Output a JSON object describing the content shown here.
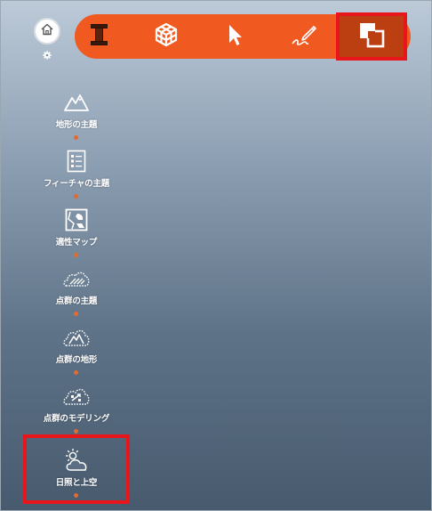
{
  "toolbar": {
    "tools": [
      {
        "name": "tool-textured-block",
        "icon": "textured-block-icon"
      },
      {
        "name": "tool-cube-mesh",
        "icon": "cube-mesh-icon"
      },
      {
        "name": "tool-select",
        "icon": "arrow-pointer-icon"
      },
      {
        "name": "tool-sketch",
        "icon": "pen-sketch-icon"
      },
      {
        "name": "tool-overlap",
        "icon": "overlap-squares-icon",
        "active": true
      }
    ]
  },
  "nav": {
    "items": [
      {
        "label": "地形の主題",
        "icon": "mountain-icon"
      },
      {
        "label": "フィーチャの主題",
        "icon": "feature-list-icon"
      },
      {
        "label": "適性マップ",
        "icon": "suitability-map-icon"
      },
      {
        "label": "点群の主題",
        "icon": "point-cloud-icon"
      },
      {
        "label": "点群の地形",
        "icon": "point-cloud-terrain-icon"
      },
      {
        "label": "点群のモデリング",
        "icon": "point-cloud-modeling-icon"
      },
      {
        "label": "日照と上空",
        "icon": "sun-cloud-icon",
        "highlighted": true
      }
    ]
  },
  "colors": {
    "toolbar": "#f05a20",
    "toolbar_active": "#bc3f12",
    "highlight_box": "#e8151b",
    "connector_dot": "#e66a2c"
  }
}
